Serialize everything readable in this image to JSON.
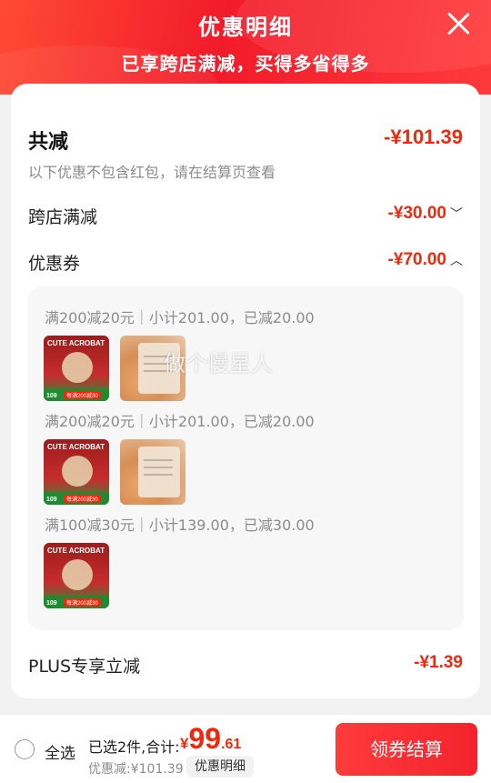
{
  "header": {
    "title": "优惠明细",
    "subtitle": "已享跨店满减，买得多省得多"
  },
  "summary": {
    "total_label": "共减",
    "total_value": "-¥101.39",
    "hint": "以下优惠不包含红包，请在结算页查看"
  },
  "rows": {
    "cross_store": {
      "label": "跨店满减",
      "value": "-¥30.00",
      "chevron": "﹀"
    },
    "coupon": {
      "label": "优惠券",
      "value": "-¥70.00",
      "chevron": "︿"
    }
  },
  "coupon_groups": [
    {
      "title": "满200减20元｜小计201.00，已减20.00"
    },
    {
      "title": "满200减20元｜小计201.00，已减20.00"
    },
    {
      "title": "满100减30元｜小计139.00，已减30.00"
    }
  ],
  "product_acrobat": {
    "name": "CUTE ACROBAT",
    "price": "109",
    "badge": "每满200减30"
  },
  "plus": {
    "label": "PLUS专享立减",
    "value": "-¥1.39"
  },
  "watermark": "做个慢星人",
  "bottom": {
    "select_all": "全选",
    "selected_text": "已选2件,合计:",
    "currency": "¥",
    "total_int": "99",
    "total_dec": ".61",
    "discount_text": "优惠减:¥101.39",
    "detail_button": "优惠明细",
    "checkout_button": "领券结算"
  },
  "colors": {
    "accent": "#f2270c",
    "header": "#f21b2a"
  },
  "icons": [
    "close-icon",
    "chevron-down-icon",
    "chevron-up-icon",
    "radio-icon"
  ]
}
